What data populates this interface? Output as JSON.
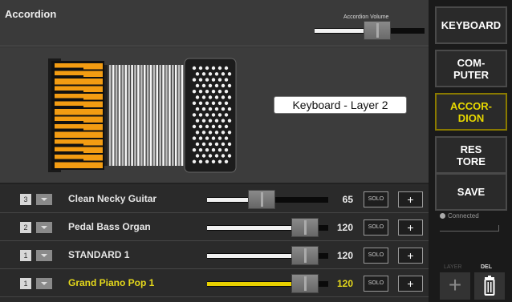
{
  "header": {
    "title": "Accordion",
    "volume_label": "Accordion Volume",
    "volume_level": 0.73
  },
  "display": {
    "layer_label": "Keyboard - Layer 2"
  },
  "channels": [
    {
      "number": "3",
      "name": "Clean Necky Guitar",
      "value": "65",
      "level": 0.54,
      "solo_label": "SOLO",
      "add_label": "+",
      "highlighted": false
    },
    {
      "number": "2",
      "name": "Pedal Bass Organ",
      "value": "120",
      "level": 1.0,
      "solo_label": "SOLO",
      "add_label": "+",
      "highlighted": false
    },
    {
      "number": "1",
      "name": "STANDARD 1",
      "value": "120",
      "level": 1.0,
      "solo_label": "SOLO",
      "add_label": "+",
      "highlighted": false
    },
    {
      "number": "1",
      "name": "Grand Piano Pop 1",
      "value": "120",
      "level": 1.0,
      "solo_label": "SOLO",
      "add_label": "+",
      "highlighted": true
    }
  ],
  "sidebar": {
    "buttons": [
      {
        "label": "KEYBOARD",
        "active": false
      },
      {
        "label": "COM-\nPUTER",
        "active": false
      },
      {
        "label": "ACCOR-\nDION",
        "active": true
      },
      {
        "label": "RES\nTORE",
        "active": false
      },
      {
        "label": "SAVE",
        "active": false
      }
    ],
    "status": "Connected",
    "layer_label": "LAYER",
    "del_label": "DEL",
    "add_icon": "plus-icon",
    "delete_icon": "trash-icon"
  },
  "colors": {
    "accent": "#e8d800",
    "piano_keys": "#f39c12"
  }
}
